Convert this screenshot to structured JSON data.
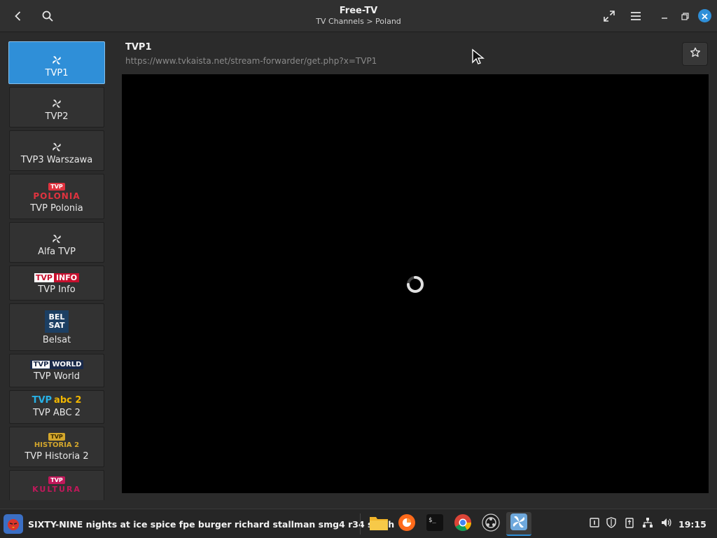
{
  "window": {
    "title": "Free-TV",
    "subtitle": "TV Channels > Poland"
  },
  "icons": {
    "back": "chevron-left-icon",
    "search": "search-icon",
    "fullscreen": "expand-icon",
    "menu": "hamburger-menu-icon",
    "minimize": "minimize-icon",
    "maximize": "maximize-icon",
    "close": "close-icon",
    "favorite": "star-icon"
  },
  "sidebar": {
    "channels": [
      {
        "name": "TVP1",
        "logo": "tvp-flower",
        "active": true
      },
      {
        "name": "TVP2",
        "logo": "tvp-flower",
        "active": false
      },
      {
        "name": "TVP3 Warszawa",
        "logo": "tvp-flower",
        "active": false
      },
      {
        "name": "TVP Polonia",
        "logo_tag": "TVP",
        "logo_text": "POLONIA",
        "active": false
      },
      {
        "name": "Alfa TVP",
        "logo": "tvp-flower",
        "active": false
      },
      {
        "name": "TVP Info",
        "logo_a": "TVP",
        "logo_b": "INFO",
        "active": false
      },
      {
        "name": "Belsat",
        "logo_l1": "BEL",
        "logo_l2": "SAT",
        "active": false
      },
      {
        "name": "TVP World",
        "logo_a": "TVP",
        "logo_b": "WORLD",
        "active": false
      },
      {
        "name": "TVP ABC 2",
        "logo_a": "TVP",
        "logo_b": "abc 2",
        "active": false
      },
      {
        "name": "TVP Historia 2",
        "logo_tag": "TVP",
        "logo_text": "HISTORIA 2",
        "active": false
      },
      {
        "name": "",
        "logo_tag": "TVP",
        "logo_text": "KULTURA",
        "active": false
      }
    ]
  },
  "main": {
    "channel_title": "TVP1",
    "stream_url": "https://www.tvkaista.net/stream-forwarder/get.php?x=TVP1",
    "player_state": "loading"
  },
  "taskbar": {
    "window_text": "SIXTY-NINE nights at ice spice fpe burger richard stallman smg4 r34 stash",
    "dock": [
      "files-icon",
      "firefox-icon",
      "terminal-icon",
      "chrome-icon",
      "obs-icon",
      "free-tv-icon"
    ],
    "tray": [
      "keyboard-layout-icon",
      "shield-icon",
      "clipboard-icon",
      "network-icon",
      "volume-icon"
    ],
    "clock": "19:15"
  },
  "colors": {
    "accent": "#2f8fd8",
    "background": "#2b2b2b",
    "video": "#000000"
  }
}
